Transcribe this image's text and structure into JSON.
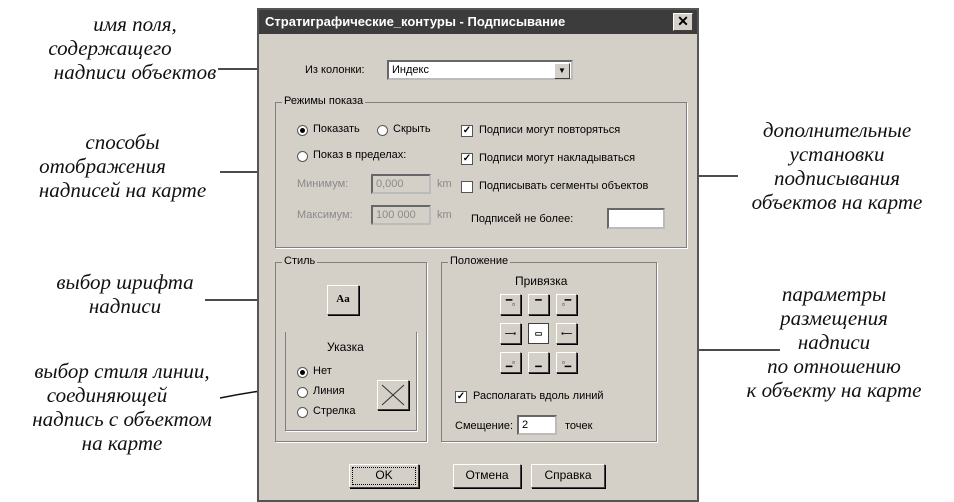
{
  "annotations": {
    "field_name": [
      "имя поля,",
      "содержащего",
      "надписи объектов"
    ],
    "display_modes": [
      "способы",
      "отображения",
      "надписей на карте"
    ],
    "font": [
      "выбор шрифта",
      "надписи"
    ],
    "line_style": [
      "выбор стиля линии,",
      "соединяющей",
      "надпись с объектом",
      "на карте"
    ],
    "extra": [
      "дополнительные",
      "установки",
      "подписывания",
      "объектов на карте"
    ],
    "placement": [
      "параметры",
      "размещения",
      "надписи",
      "по отношению",
      "к объекту на карте"
    ]
  },
  "dialog": {
    "title": "Стратиграфические_контуры - Подписывание",
    "close_glyph": "✕",
    "column_label": "Из колонки:",
    "column_value": "Индекс",
    "modes": {
      "title": "Режимы показа",
      "show": "Показать",
      "hide": "Скрыть",
      "range": "Показ в пределах:",
      "min_label": "Минимум:",
      "min_value": "0,000",
      "max_label": "Максимум:",
      "max_value": "100 000",
      "unit": "km",
      "repeat": "Подписи могут повторяться",
      "overlap": "Подписи могут накладываться",
      "segments": "Подписывать сегменты объектов",
      "limit_label": "Подписей не более:",
      "limit_value": ""
    },
    "style": {
      "title": "Стиль",
      "font_btn": "Aa",
      "pointer_title": "Указка",
      "none": "Нет",
      "line": "Линия",
      "arrow": "Стрелка"
    },
    "position": {
      "title": "Положение",
      "anchor_title": "Привязка",
      "along": "Располагать вдоль линий",
      "offset_label": "Смещение:",
      "offset_value": "2",
      "offset_unit": "точек"
    },
    "buttons": {
      "ok": "OK",
      "cancel": "Отмена",
      "help": "Справка"
    }
  }
}
